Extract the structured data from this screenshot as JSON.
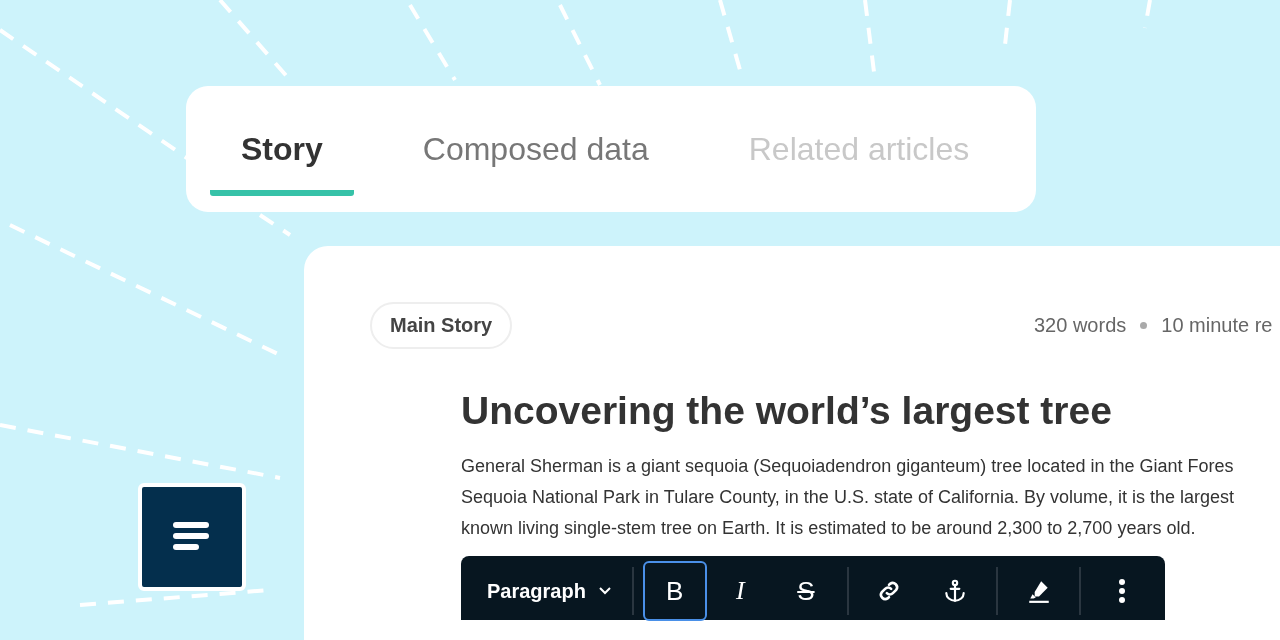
{
  "tabs": [
    {
      "label": "Story",
      "selected": true,
      "disabled": false
    },
    {
      "label": "Composed data",
      "selected": false,
      "disabled": false
    },
    {
      "label": "Related articles",
      "selected": false,
      "disabled": true
    }
  ],
  "story": {
    "badge": "Main Story",
    "word_count": "320 words",
    "read_time": "10 minute re",
    "title": "Uncovering the world’s largest tree",
    "body_lines": [
      "General Sherman is a giant sequoia (Sequoiadendron giganteum) tree located in the Giant Fores",
      "Sequoia National Park in Tulare County, in the U.S. state of California. By volume, it is the largest",
      "known living single-stem tree on Earth. It is estimated to be around 2,300 to 2,700 years old."
    ]
  },
  "toolbar": {
    "block_style": "Paragraph",
    "buttons": [
      {
        "kind": "bold",
        "label": "B",
        "selected": true
      },
      {
        "kind": "italic",
        "label": "I",
        "selected": false
      },
      {
        "kind": "strike",
        "label": "S",
        "selected": false
      },
      {
        "kind": "link",
        "selected": false
      },
      {
        "kind": "anchor",
        "selected": false
      },
      {
        "kind": "highlight",
        "selected": false
      },
      {
        "kind": "more",
        "selected": false
      }
    ]
  }
}
